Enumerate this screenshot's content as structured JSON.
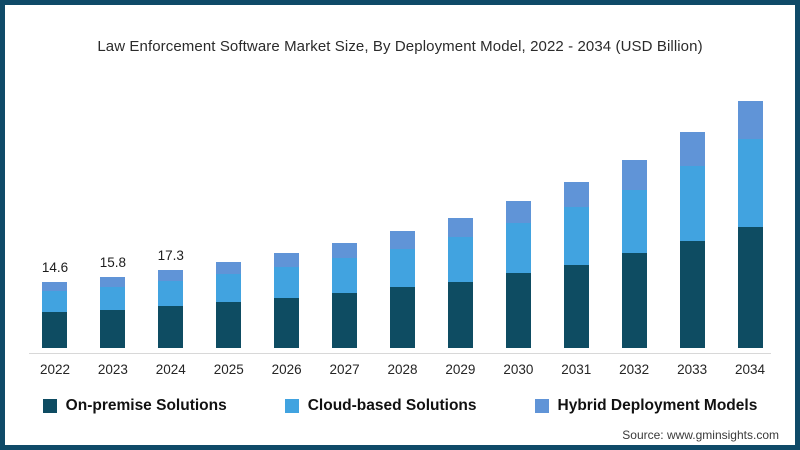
{
  "title": "Law Enforcement Software Market Size, By Deployment Model, 2022 - 2034 (USD Billion)",
  "source_text": "Source: www.gminsights.com",
  "colors": {
    "on_premise": "#0e4c62",
    "cloud": "#41a3e0",
    "hybrid": "#6094d7",
    "frame_border": "#0f4a68",
    "axis_line": "#d8d8d8"
  },
  "legend": [
    {
      "label": "On-premise Solutions",
      "color": "#0e4c62"
    },
    {
      "label": "Cloud-based Solutions",
      "color": "#41a3e0"
    },
    {
      "label": "Hybrid Deployment Models",
      "color": "#6094d7"
    }
  ],
  "chart_data": {
    "type": "bar",
    "stacked": true,
    "title": "Law Enforcement Software Market Size, By Deployment Model, 2022 - 2034 (USD Billion)",
    "xlabel": "",
    "ylabel": "USD Billion",
    "grid": false,
    "legend_position": "bottom",
    "categories": [
      "2022",
      "2023",
      "2024",
      "2025",
      "2026",
      "2027",
      "2028",
      "2029",
      "2030",
      "2031",
      "2032",
      "2033",
      "2034"
    ],
    "series": [
      {
        "name": "On-premise Solutions",
        "color": "#0e4c62",
        "values": [
          7.9,
          8.5,
          9.3,
          10.2,
          11.2,
          12.3,
          13.5,
          14.7,
          16.6,
          18.4,
          21.1,
          23.8,
          27.0
        ]
      },
      {
        "name": "Cloud-based Solutions",
        "color": "#41a3e0",
        "values": [
          4.7,
          5.1,
          5.6,
          6.2,
          6.9,
          7.6,
          8.6,
          10.0,
          11.2,
          12.9,
          14.0,
          16.6,
          19.4
        ]
      },
      {
        "name": "Hybrid Deployment Models",
        "color": "#6094d7",
        "values": [
          2.0,
          2.2,
          2.4,
          2.7,
          3.0,
          3.4,
          3.8,
          4.3,
          4.8,
          5.5,
          6.7,
          7.5,
          8.6
        ]
      }
    ],
    "totals": [
      14.6,
      15.8,
      17.3,
      19.1,
      21.1,
      23.3,
      25.9,
      29.0,
      32.6,
      36.8,
      41.8,
      47.9,
      55.0
    ],
    "bar_labels": [
      "14.6",
      "15.8",
      "17.3",
      "",
      "",
      "",
      "",
      "",
      "",
      "",
      "",
      "",
      ""
    ],
    "ylim": [
      0,
      57
    ]
  }
}
